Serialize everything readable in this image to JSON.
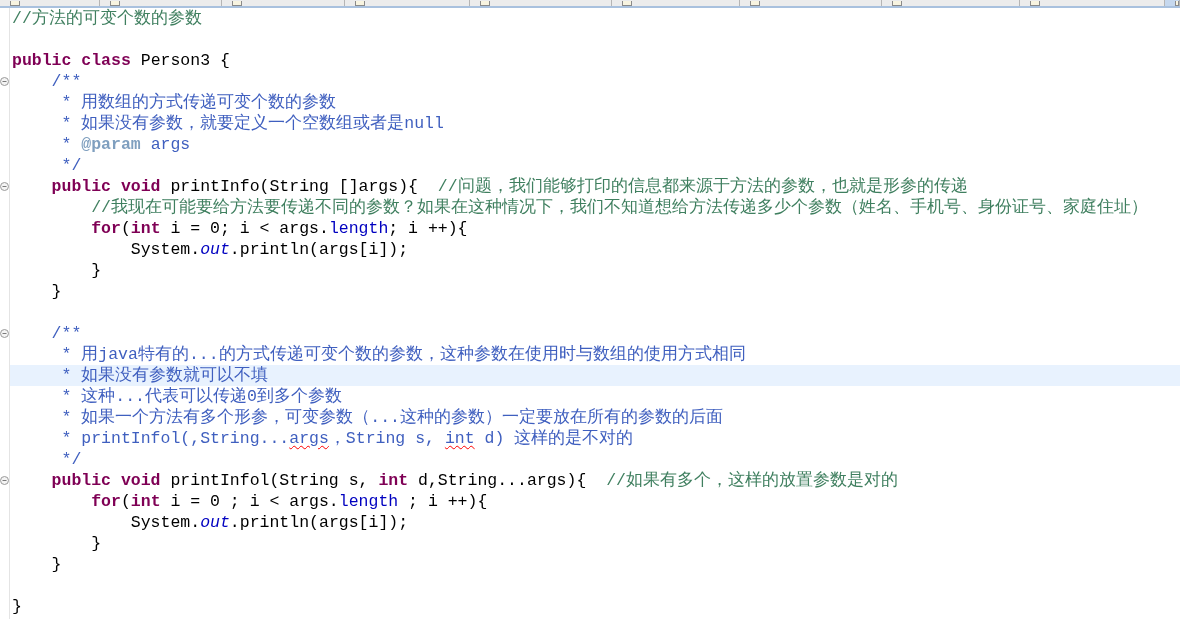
{
  "tabs": [
    {
      "selected": false
    },
    {
      "selected": false
    },
    {
      "selected": false
    },
    {
      "selected": false
    },
    {
      "selected": false
    },
    {
      "selected": false
    },
    {
      "selected": false
    },
    {
      "selected": false
    },
    {
      "selected": false
    },
    {
      "selected": true
    }
  ],
  "lines": [
    {
      "fold_marker": false,
      "selected": false,
      "tokens": [
        {
          "kind": "comment",
          "text": "//方法的可变个数的参数"
        }
      ]
    },
    {
      "fold_marker": false,
      "selected": false
    },
    {
      "fold_marker": false,
      "selected": false,
      "tokens": [
        {
          "kind": "keyword",
          "text": "public class"
        },
        {
          "kind": "plain",
          "text": " Person3 {"
        }
      ]
    },
    {
      "fold_marker": true,
      "selected": false,
      "tokens": [
        {
          "kind": "doc",
          "text": "    /**"
        }
      ]
    },
    {
      "fold_marker": false,
      "selected": false,
      "tokens": [
        {
          "kind": "doc",
          "text": "     * 用数组的方式传递可变个数的参数"
        }
      ]
    },
    {
      "fold_marker": false,
      "selected": false,
      "tokens": [
        {
          "kind": "doc",
          "text": "     * 如果没有参数，就要定义一个空数组或者是null"
        }
      ]
    },
    {
      "fold_marker": false,
      "selected": false,
      "tokens": [
        {
          "kind": "doc",
          "text": "     * "
        },
        {
          "kind": "tag",
          "text": "@param"
        },
        {
          "kind": "doc",
          "text": " args"
        }
      ]
    },
    {
      "fold_marker": false,
      "selected": false,
      "tokens": [
        {
          "kind": "doc",
          "text": "     */"
        }
      ]
    },
    {
      "fold_marker": true,
      "selected": false,
      "tokens": [
        {
          "kind": "keyword",
          "text": "    public void"
        },
        {
          "kind": "plain",
          "text": " printInfo(String []args){  "
        },
        {
          "kind": "comment",
          "text": "//问题，我们能够打印的信息都来源于方法的参数，也就是形参的传递"
        }
      ]
    },
    {
      "fold_marker": false,
      "selected": false,
      "tokens": [
        {
          "kind": "comment",
          "text": "        //我现在可能要给方法要传递不同的参数？如果在这种情况下，我们不知道想给方法传递多少个参数（姓名、手机号、身份证号、家庭住址）"
        }
      ]
    },
    {
      "fold_marker": false,
      "selected": false,
      "tokens": [
        {
          "kind": "keyword",
          "text": "        for"
        },
        {
          "kind": "plain",
          "text": "("
        },
        {
          "kind": "keyword",
          "text": "int"
        },
        {
          "kind": "plain",
          "text": " i = 0; i < args."
        },
        {
          "kind": "member",
          "text": "length"
        },
        {
          "kind": "plain",
          "text": "; i ++){"
        }
      ]
    },
    {
      "fold_marker": false,
      "selected": false,
      "tokens": [
        {
          "kind": "plain",
          "text": "            System."
        },
        {
          "kind": "static",
          "text": "out"
        },
        {
          "kind": "plain",
          "text": ".println(args[i]);"
        }
      ]
    },
    {
      "fold_marker": false,
      "selected": false,
      "tokens": [
        {
          "kind": "plain",
          "text": "        }"
        }
      ]
    },
    {
      "fold_marker": false,
      "selected": false,
      "tokens": [
        {
          "kind": "plain",
          "text": "    }"
        }
      ]
    },
    {
      "fold_marker": false,
      "selected": false
    },
    {
      "fold_marker": true,
      "selected": false,
      "tokens": [
        {
          "kind": "doc",
          "text": "    /**"
        }
      ]
    },
    {
      "fold_marker": false,
      "selected": false,
      "tokens": [
        {
          "kind": "doc",
          "text": "     * 用java特有的...的方式传递可变个数的参数，这种参数在使用时与数组的使用方式相同"
        }
      ]
    },
    {
      "fold_marker": false,
      "selected": true,
      "tokens": [
        {
          "kind": "doc",
          "text": "     * 如果没有参数就可以不填"
        }
      ]
    },
    {
      "fold_marker": false,
      "selected": false,
      "tokens": [
        {
          "kind": "doc",
          "text": "     * 这种...代表可以传递0到多个参数"
        }
      ]
    },
    {
      "fold_marker": false,
      "selected": false,
      "tokens": [
        {
          "kind": "doc",
          "text": "     * 如果一个方法有多个形参，可变参数（...这种的参数）一定要放在所有的参数的后面"
        }
      ]
    },
    {
      "fold_marker": false,
      "selected": false,
      "tokens": [
        {
          "kind": "doc",
          "text": "     * printInfol(,String..."
        },
        {
          "kind": "misspelled",
          "text": "args"
        },
        {
          "kind": "doc",
          "text": "，String s, "
        },
        {
          "kind": "misspelled",
          "text": "int"
        },
        {
          "kind": "doc",
          "text": " d) 这样的是不对的"
        }
      ]
    },
    {
      "fold_marker": false,
      "selected": false,
      "tokens": [
        {
          "kind": "doc",
          "text": "     */"
        }
      ]
    },
    {
      "fold_marker": true,
      "selected": false,
      "tokens": [
        {
          "kind": "keyword",
          "text": "    public void"
        },
        {
          "kind": "plain",
          "text": " printInfol(String s, "
        },
        {
          "kind": "keyword",
          "text": "int"
        },
        {
          "kind": "plain",
          "text": " d,String...args){  "
        },
        {
          "kind": "comment",
          "text": "//如果有多个，这样的放置参数是对的"
        }
      ]
    },
    {
      "fold_marker": false,
      "selected": false,
      "tokens": [
        {
          "kind": "keyword",
          "text": "        for"
        },
        {
          "kind": "plain",
          "text": "("
        },
        {
          "kind": "keyword",
          "text": "int"
        },
        {
          "kind": "plain",
          "text": " i = 0 ; i < args."
        },
        {
          "kind": "member",
          "text": "length"
        },
        {
          "kind": "plain",
          "text": " ; i ++){"
        }
      ]
    },
    {
      "fold_marker": false,
      "selected": false,
      "tokens": [
        {
          "kind": "plain",
          "text": "            System."
        },
        {
          "kind": "static",
          "text": "out"
        },
        {
          "kind": "plain",
          "text": ".println(args[i]);"
        }
      ]
    },
    {
      "fold_marker": false,
      "selected": false,
      "tokens": [
        {
          "kind": "plain",
          "text": "        }"
        }
      ]
    },
    {
      "fold_marker": false,
      "selected": false,
      "tokens": [
        {
          "kind": "plain",
          "text": "    }"
        }
      ]
    },
    {
      "fold_marker": false,
      "selected": false
    },
    {
      "fold_marker": false,
      "selected": false,
      "tokens": [
        {
          "kind": "plain",
          "text": "}"
        }
      ]
    }
  ]
}
